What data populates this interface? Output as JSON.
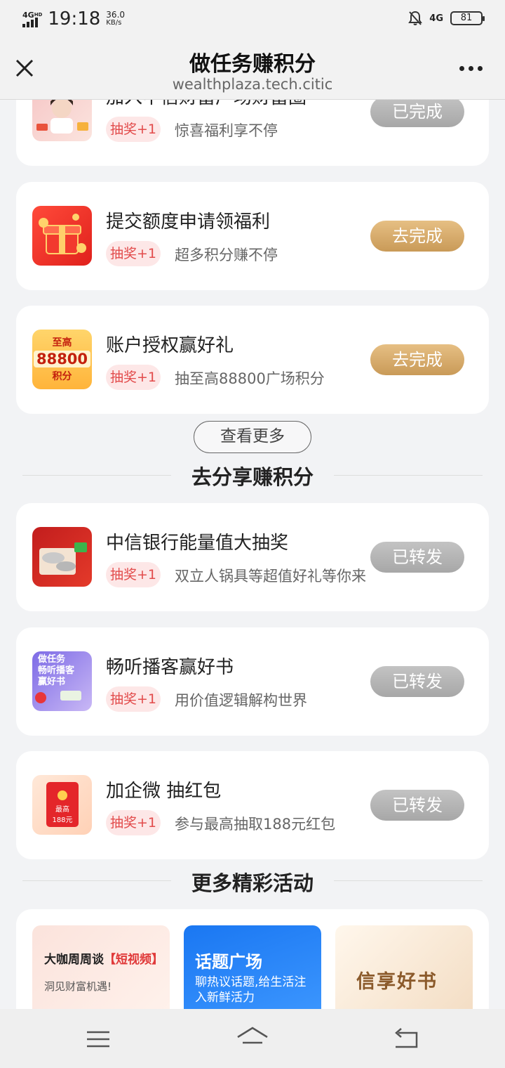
{
  "status_bar": {
    "network": "4G",
    "network_sup": "HD",
    "time": "19:18",
    "speed_value": "36.0",
    "speed_unit": "KB/s",
    "right_network": "4G",
    "battery": "81"
  },
  "header": {
    "title": "做任务赚积分",
    "url": "wealthplaza.tech.citic"
  },
  "tasks": [
    {
      "title": "加入中信财富广场财富圈",
      "tag": "抽奖+1",
      "desc": "惊喜福利享不停",
      "button": "已完成",
      "state": "done"
    },
    {
      "title": "提交额度申请领福利",
      "tag": "抽奖+1",
      "desc": "超多积分赚不停",
      "button": "去完成",
      "state": "todo"
    },
    {
      "title": "账户授权赢好礼",
      "tag": "抽奖+1",
      "desc": "抽至高88800广场积分",
      "button": "去完成",
      "state": "todo",
      "icon_top": "至高",
      "icon_mid": "88800",
      "icon_bot": "积分"
    }
  ],
  "more_button": "查看更多",
  "share_section": {
    "title": "去分享赚积分",
    "items": [
      {
        "title": "中信银行能量值大抽奖",
        "tag": "抽奖+1",
        "desc": "双立人锅具等超值好礼等你来",
        "button": "已转发"
      },
      {
        "title": "畅听播客赢好书",
        "tag": "抽奖+1",
        "desc": "用价值逻辑解构世界",
        "button": "已转发",
        "icon_text": "做任务\n畅听播客\n赢好书"
      },
      {
        "title": "加企微 抽红包",
        "tag": "抽奖+1",
        "desc": "参与最高抽取188元红包",
        "button": "已转发",
        "icon_text1": "最高",
        "icon_text2": "188元"
      }
    ]
  },
  "activities": {
    "title": "更多精彩活动",
    "banners": [
      {
        "title_prefix": "大咖周周谈",
        "title_highlight": "【短视频】",
        "subtitle": "洞见财富机遇!"
      },
      {
        "title": "话题广场",
        "subtitle": "聊热议话题,给生活注入新鲜活力"
      },
      {
        "title": "信享好书"
      }
    ]
  },
  "colors": {
    "accent_gold": "#c99a58",
    "done_gray": "#a7a7a7",
    "tag_red": "#e24b4b"
  }
}
